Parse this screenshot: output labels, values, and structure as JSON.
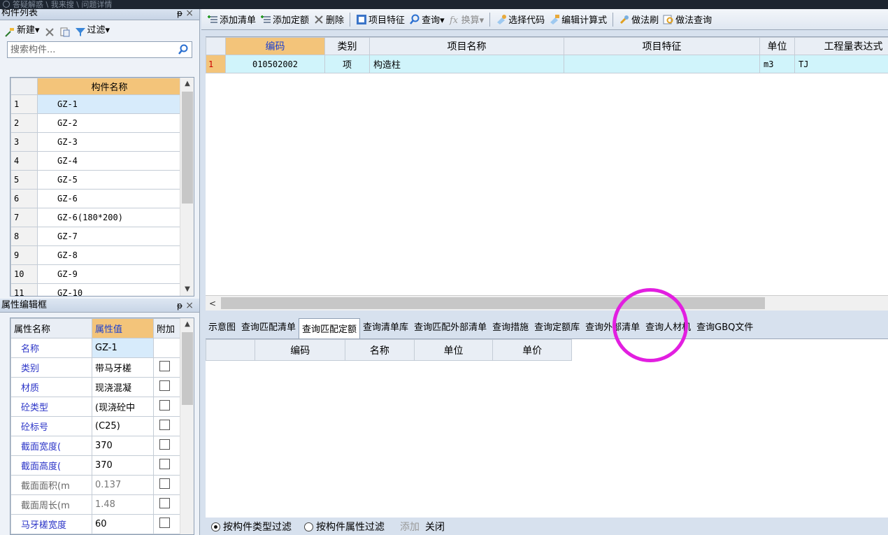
{
  "top_overlay": {
    "text": "答疑解惑 \\ 我来搜 \\ 问题详情"
  },
  "component_list": {
    "title": "构件列表",
    "pin": "ᵽ",
    "close": "×",
    "toolbar": {
      "new_label": "新建▾",
      "filter_label": "过滤▾"
    },
    "search_placeholder": "搜索构件...",
    "header": "构件名称",
    "rows": [
      {
        "num": "1",
        "name": "GZ-1"
      },
      {
        "num": "2",
        "name": "GZ-2"
      },
      {
        "num": "3",
        "name": "GZ-3"
      },
      {
        "num": "4",
        "name": "GZ-4"
      },
      {
        "num": "5",
        "name": "GZ-5"
      },
      {
        "num": "6",
        "name": "GZ-6"
      },
      {
        "num": "7",
        "name": "GZ-6(180*200)"
      },
      {
        "num": "8",
        "name": "GZ-7"
      },
      {
        "num": "9",
        "name": "GZ-8"
      },
      {
        "num": "10",
        "name": "GZ-9"
      },
      {
        "num": "11",
        "name": "GZ-10"
      }
    ]
  },
  "property_editor": {
    "title": "属性编辑框",
    "pin": "ᵽ",
    "close": "×",
    "headers": {
      "name": "属性名称",
      "value": "属性值",
      "extra": "附加"
    },
    "rows": [
      {
        "name": "名称",
        "value": "GZ-1"
      },
      {
        "name": "类别",
        "value": "带马牙槎"
      },
      {
        "name": "材质",
        "value": "现浇混凝"
      },
      {
        "name": "砼类型",
        "value": "(现浇砼中"
      },
      {
        "name": "砼标号",
        "value": "(C25)"
      },
      {
        "name": "截面宽度(",
        "value": "370"
      },
      {
        "name": "截面高度(",
        "value": "370"
      },
      {
        "name": "截面面积(m",
        "value": "0.137"
      },
      {
        "name": "截面周长(m",
        "value": "1.48"
      },
      {
        "name": "马牙槎宽度",
        "value": "60"
      }
    ]
  },
  "main_toolbar": {
    "add_list": "添加清单",
    "add_quota": "添加定额",
    "delete": "删除",
    "item_feature": "项目特征",
    "query": "查询▾",
    "convert": "换算▾",
    "select_code": "选择代码",
    "edit_formula": "编辑计算式",
    "method_brush": "做法刷",
    "method_query": "做法查询"
  },
  "list_grid": {
    "headers": {
      "code": "编码",
      "category": "类别",
      "item_name": "项目名称",
      "item_feature": "项目特征",
      "unit": "单位",
      "expression": "工程量表达式"
    },
    "rows": [
      {
        "num": "1",
        "code": "010502002",
        "category": "项",
        "item_name": "构造柱",
        "item_feature": "",
        "unit": "m3",
        "expression": "TJ"
      }
    ]
  },
  "query_tabs": [
    "示意图",
    "查询匹配清单",
    "查询匹配定额",
    "查询清单库",
    "查询匹配外部清单",
    "查询措施",
    "查询定额库",
    "查询外部清单",
    "查询人材机",
    "查询GBQ文件"
  ],
  "active_query_tab": "查询匹配定额",
  "quota_grid": {
    "headers": {
      "code": "编码",
      "name": "名称",
      "unit": "单位",
      "price": "单价"
    }
  },
  "filter_bar": {
    "by_type": "按构件类型过滤",
    "by_attr": "按构件属性过滤",
    "add": "添加",
    "close": "关闭"
  },
  "colors": {
    "header_orange": "#f3c47a",
    "row_cyan": "#d0f4fb",
    "highlight_magenta": "#e21fe0",
    "selected_blue": "#d7ebfb"
  }
}
